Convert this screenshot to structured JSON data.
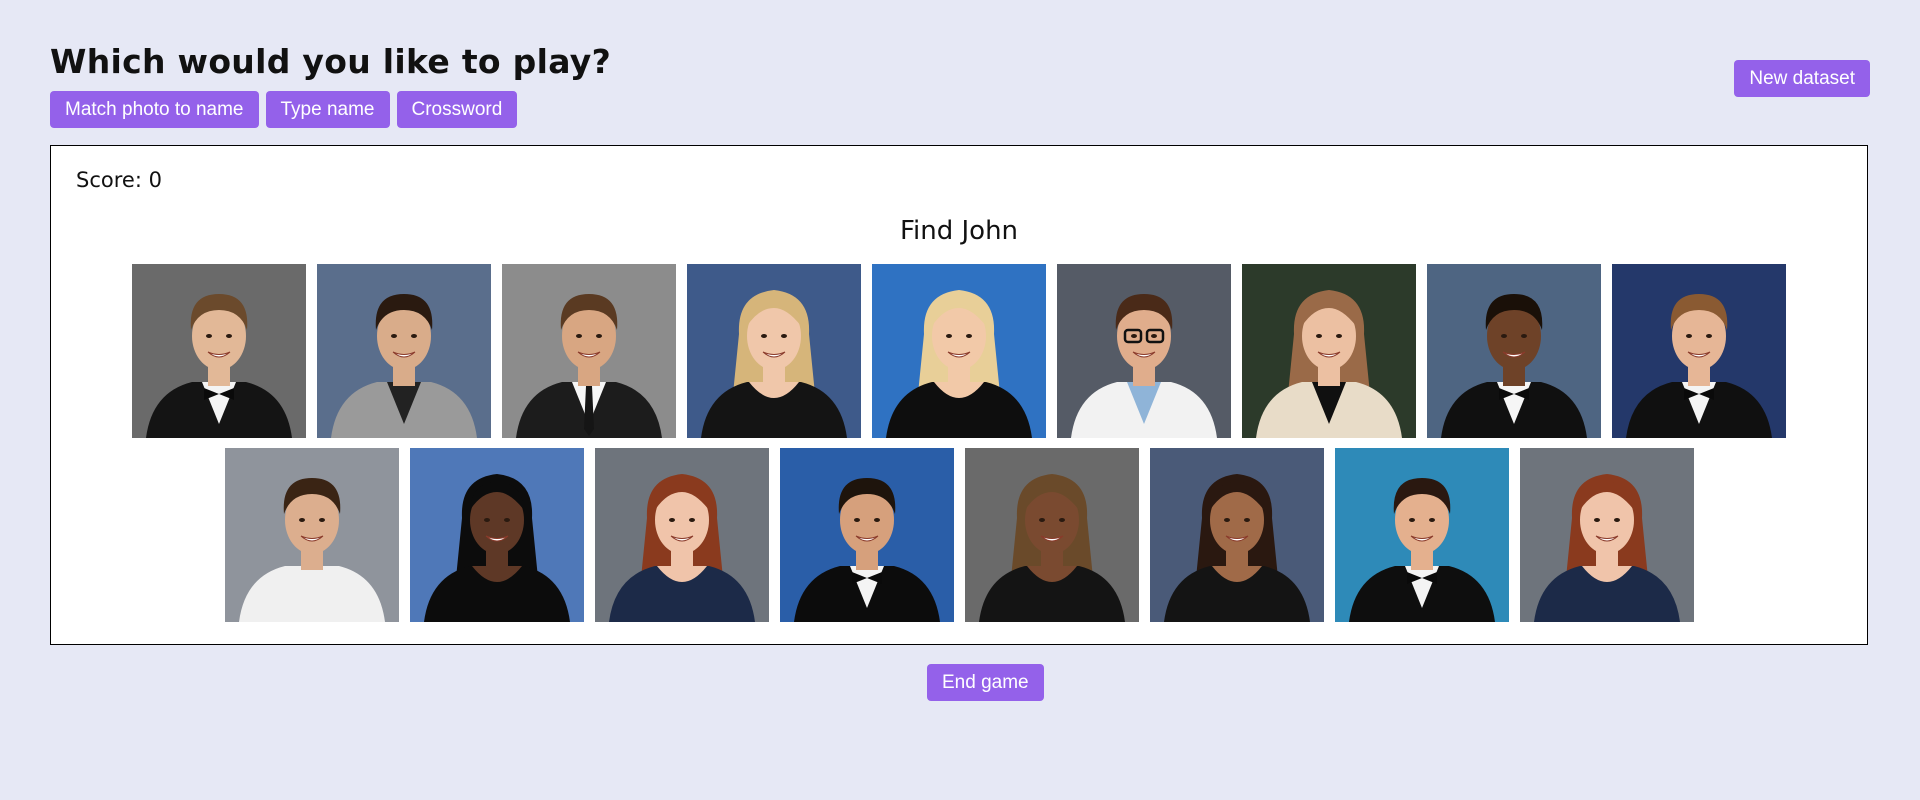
{
  "header": {
    "title": "Which would you like to play?",
    "modes": [
      {
        "label": "Match photo to name"
      },
      {
        "label": "Type name"
      },
      {
        "label": "Crossword"
      }
    ],
    "new_dataset_label": "New dataset"
  },
  "game": {
    "score_text": "Score: 0",
    "prompt": "Find John",
    "end_game_label": "End game"
  },
  "photos": [
    {
      "bg": "#6a6a6a",
      "hair": "#6b4a2c",
      "skin": "#e2b897",
      "outfit": "#141414",
      "shirt": "#f4f4f4",
      "icon": "tuxedo-portrait"
    },
    {
      "bg": "#5a6e8c",
      "hair": "#2a1a10",
      "skin": "#d9ac8a",
      "outfit": "#9a9a9a",
      "shirt": "#222222",
      "icon": "jacket-portrait"
    },
    {
      "bg": "#8c8c8c",
      "hair": "#5a3a22",
      "skin": "#d8a682",
      "outfit": "#1c1c1c",
      "shirt": "#f6f6f6",
      "icon": "suit-portrait"
    },
    {
      "bg": "#3e5a8a",
      "hair": "#d6b57a",
      "skin": "#f0c7aa",
      "outfit": "#141414",
      "shirt": "#141414",
      "icon": "dress-portrait"
    },
    {
      "bg": "#2f72c2",
      "hair": "#e8cf98",
      "skin": "#f2c9a8",
      "outfit": "#0e0e0e",
      "shirt": "#0e0e0e",
      "icon": "dress-portrait"
    },
    {
      "bg": "#555b66",
      "hair": "#4a2a18",
      "skin": "#e0ad8c",
      "outfit": "#f2f2f2",
      "shirt": "#8fb4d8",
      "icon": "labcoat-portrait"
    },
    {
      "bg": "#2c3a2a",
      "hair": "#9a6a48",
      "skin": "#ecc0a2",
      "outfit": "#e8dcc8",
      "shirt": "#101010",
      "icon": "cardigan-portrait"
    },
    {
      "bg": "#4e6582",
      "hair": "#1a1008",
      "skin": "#6e4228",
      "outfit": "#101010",
      "shirt": "#f6f6f6",
      "icon": "tuxedo-portrait"
    },
    {
      "bg": "#24386a",
      "hair": "#8a5a32",
      "skin": "#e6b696",
      "outfit": "#101010",
      "shirt": "#f4f4f4",
      "icon": "tuxedo-portrait"
    },
    {
      "bg": "#8f949c",
      "hair": "#3a2414",
      "skin": "#dcae8e",
      "outfit": "#f0f0f0",
      "shirt": "#f0f0f0",
      "icon": "shirt-portrait"
    },
    {
      "bg": "#4f78b8",
      "hair": "#0c0c0c",
      "skin": "#5e3826",
      "outfit": "#0c0c0c",
      "shirt": "#0c0c0c",
      "icon": "dress-portrait"
    },
    {
      "bg": "#6e747c",
      "hair": "#8a3a1e",
      "skin": "#f0c4aa",
      "outfit": "#1c2a48",
      "shirt": "#1c2a48",
      "icon": "dress-portrait"
    },
    {
      "bg": "#2a5ea8",
      "hair": "#1e140c",
      "skin": "#d6a07c",
      "outfit": "#0c0c0c",
      "shirt": "#f4f4f4",
      "icon": "tuxedo-portrait"
    },
    {
      "bg": "#6a6a6a",
      "hair": "#6a4a2a",
      "skin": "#7a4a30",
      "outfit": "#141414",
      "shirt": "#141414",
      "icon": "dress-portrait"
    },
    {
      "bg": "#4a5a78",
      "hair": "#2a1810",
      "skin": "#a06a48",
      "outfit": "#141414",
      "shirt": "#141414",
      "icon": "dress-portrait"
    },
    {
      "bg": "#2e8ab8",
      "hair": "#2a1810",
      "skin": "#e4b08e",
      "outfit": "#0e0e0e",
      "shirt": "#f4f4f4",
      "icon": "tuxedo-portrait"
    },
    {
      "bg": "#6e747c",
      "hair": "#8a3a1e",
      "skin": "#f0c4aa",
      "outfit": "#1c2a48",
      "shirt": "#1c2a48",
      "icon": "dress-portrait"
    }
  ]
}
